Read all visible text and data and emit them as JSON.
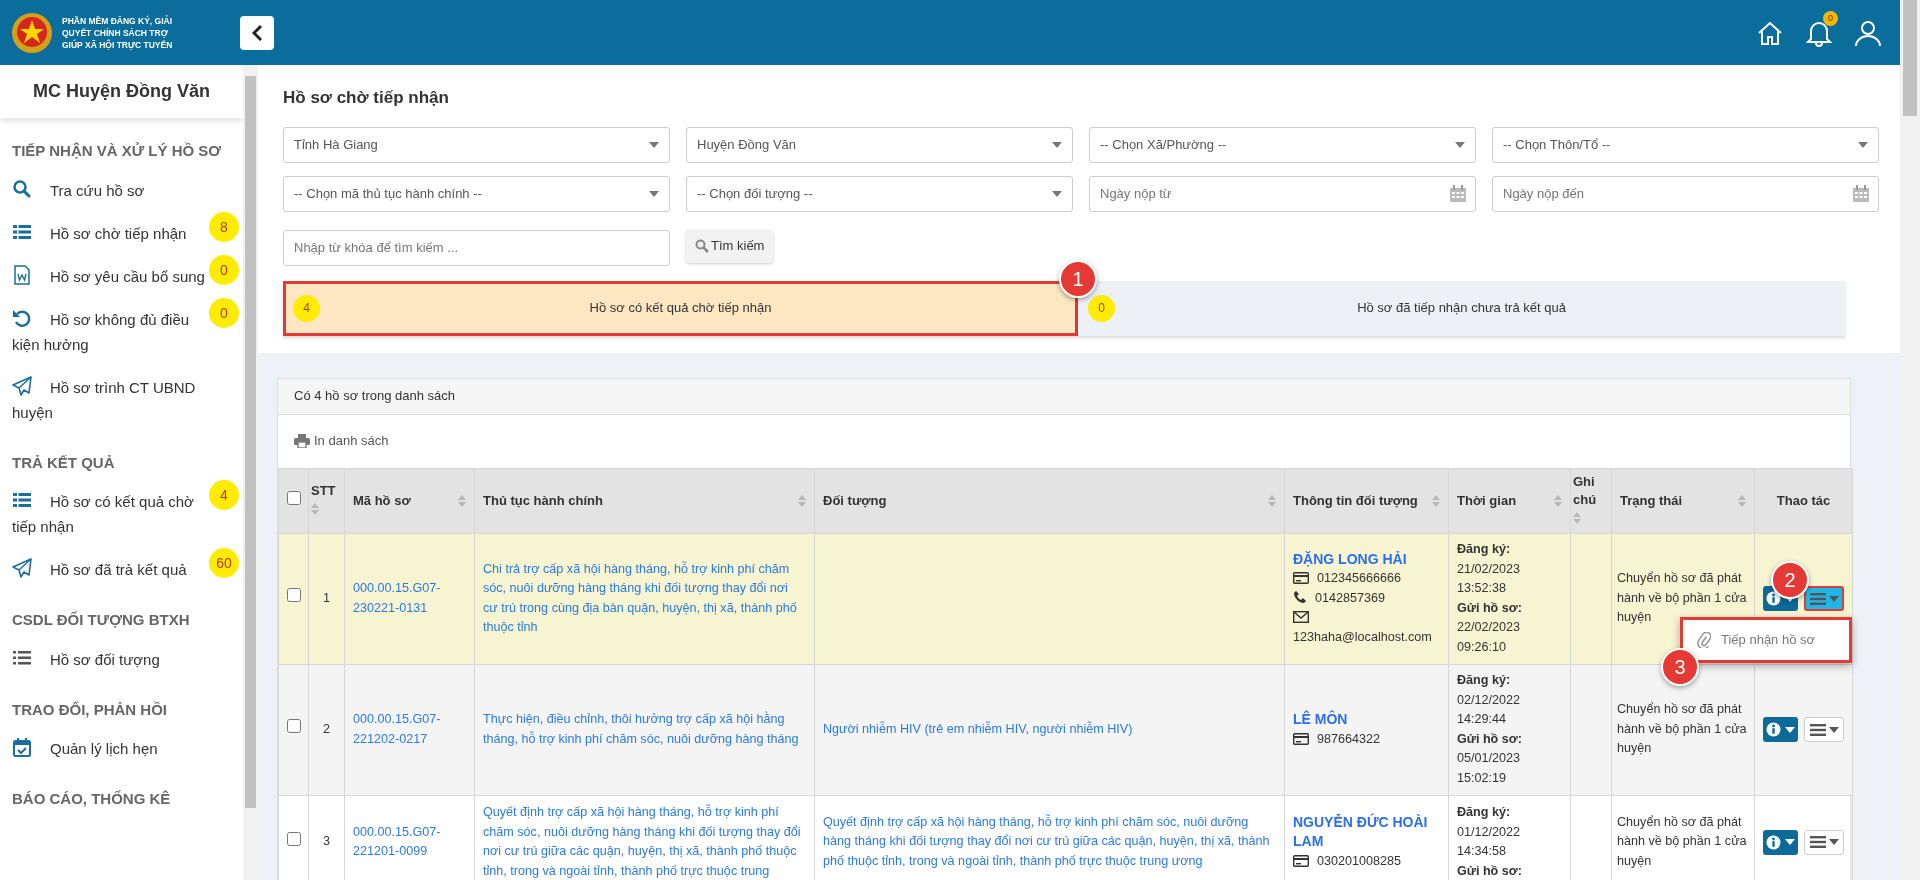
{
  "header": {
    "logo_lines": [
      "PHẦN MỀM ĐĂNG KÝ, GIẢI",
      "QUYẾT CHÍNH SÁCH TRỢ",
      "GIÚP XÃ HỘI TRỰC TUYẾN"
    ],
    "notification_count": "0"
  },
  "sidebar": {
    "title": "MC Huyện Đồng Văn",
    "sections": [
      {
        "heading": "TIẾP NHẬN VÀ XỬ LÝ HỒ SƠ",
        "items": [
          {
            "label": "Tra cứu hồ sơ"
          },
          {
            "label": "Hồ sơ chờ tiếp nhận",
            "badge": "8"
          },
          {
            "label": "Hồ sơ yêu cầu bổ sung",
            "badge": "0"
          },
          {
            "label": "Hồ sơ không đủ điều kiện hưởng",
            "badge": "0"
          },
          {
            "label": "Hồ sơ trình CT UBND huyện"
          }
        ]
      },
      {
        "heading": "TRẢ KẾT QUẢ",
        "items": [
          {
            "label": "Hồ sơ có kết quả chờ tiếp nhận",
            "badge": "4"
          },
          {
            "label": "Hồ sơ đã trả kết quả",
            "badge": "60"
          }
        ]
      },
      {
        "heading": "CSDL ĐỐI TƯỢNG BTXH",
        "items": [
          {
            "label": "Hồ sơ đối tượng"
          }
        ]
      },
      {
        "heading": "TRAO ĐỔI, PHẢN HỒI",
        "items": [
          {
            "label": "Quản lý lịch hẹn"
          }
        ]
      },
      {
        "heading": "BÁO CÁO, THỐNG KÊ"
      }
    ]
  },
  "page_title": "Hồ sơ chờ tiếp nhận",
  "filters": [
    {
      "kind": "select",
      "value": "Tỉnh Hà Giang"
    },
    {
      "kind": "select",
      "value": "Huyện Đồng Văn"
    },
    {
      "kind": "select",
      "value": "-- Chọn Xã/Phường --"
    },
    {
      "kind": "select",
      "value": "-- Chọn Thôn/Tổ --"
    },
    {
      "kind": "select",
      "value": "-- Chọn mã thủ tục hành chính --"
    },
    {
      "kind": "select",
      "value": "-- Chọn đối tượng --"
    },
    {
      "kind": "date",
      "placeholder": "Ngày nộp từ"
    },
    {
      "kind": "date",
      "placeholder": "Ngày nộp đến"
    },
    {
      "kind": "text",
      "placeholder": "Nhập từ khóa để tìm kiếm ..."
    },
    {
      "kind": "button",
      "label": "Tìm kiếm"
    }
  ],
  "tabs": [
    {
      "count": "4",
      "label": "Hồ sơ có kết quả chờ tiếp nhận",
      "selected": true,
      "highlighted": true,
      "marker": "1"
    },
    {
      "count": "0",
      "label": "Hồ sơ đã tiếp nhận chưa trả kết quả",
      "selected": false,
      "highlighted": false
    }
  ],
  "list": {
    "summary": "Có 4 hồ sơ trong danh sách",
    "print_label": "In danh sách",
    "columns": [
      {
        "kind": "checkbox",
        "checked": false
      },
      {
        "label": "STT",
        "sortable": true
      },
      {
        "label": "Mã hồ sơ",
        "sortable": true
      },
      {
        "label": "Thủ tục hành chính",
        "sortable": true
      },
      {
        "label": "Đối tượng",
        "sortable": true
      },
      {
        "label": "Thông tin đối tượng",
        "sortable": true
      },
      {
        "label": "Thời gian",
        "sortable": true
      },
      {
        "label": "Ghi chú",
        "sortable": true
      },
      {
        "label": "Trạng thái",
        "sortable": true
      },
      {
        "label": "Thao tác",
        "sortable": false
      }
    ],
    "rows": [
      {
        "checked": false,
        "highlighted": true,
        "index": "1",
        "code": "000.00.15.G07-230221-0131",
        "procedure": "Chi trả trợ cấp xã hội hàng tháng, hỗ trợ kinh phí chăm sóc, nuôi dưỡng hàng tháng khi đối tượng thay đổi nơi cư trú trong cùng địa bàn quận, huyện, thị xã, thành phố thuộc tỉnh",
        "contact": {
          "name": "ĐẶNG LONG HẢI",
          "lines": [
            {
              "kind": "id",
              "text": "012345666666"
            },
            {
              "kind": "phone",
              "text": "0142857369"
            },
            {
              "kind": "email",
              "text": "123haha@localhost.com"
            }
          ]
        },
        "times": [
          {
            "label": "Đăng ký:",
            "date": "21/02/2023",
            "time": "13:52:38"
          },
          {
            "label": "Gửi hồ sơ:",
            "date": "22/02/2023",
            "time": "09:26:10"
          }
        ],
        "status": "Chuyển hồ sơ đã phát hành về bộ phần 1 cửa huyện",
        "menu": {
          "open": true,
          "button_marker": "2",
          "list_marker": "3",
          "items": [
            {
              "label": "Tiếp nhận hồ sơ"
            }
          ]
        }
      },
      {
        "checked": false,
        "highlighted": false,
        "index": "2",
        "code": "000.00.15.G07-221202-0217",
        "procedure": "Thực hiện, điều chỉnh, thôi hưởng trợ cấp xã hội hằng tháng, hỗ trợ kinh phí chăm sóc, nuôi dưỡng hàng tháng",
        "subject": "Người nhiễm HIV (trẻ em nhiễm HIV, người nhiễm HIV)",
        "contact": {
          "name": "LÊ MÔN",
          "lines": [
            {
              "kind": "id",
              "text": "987664322"
            }
          ]
        },
        "times": [
          {
            "label": "Đăng ký:",
            "date": "02/12/2022",
            "time": "14:29:44"
          },
          {
            "label": "Gửi hồ sơ:",
            "date": "05/01/2023",
            "time": "15:02:19"
          }
        ],
        "status": "Chuyển hồ sơ đã phát hành về bộ phần 1 cửa huyện",
        "menu": {
          "open": false
        }
      },
      {
        "checked": false,
        "highlighted": false,
        "index": "3",
        "code": "000.00.15.G07-221201-0099",
        "procedure": "Quyết định trợ cấp xã hội hàng tháng, hỗ trợ kinh phí chăm sóc, nuôi dưỡng hàng tháng khi đối tượng thay đổi nơi cư trú giữa các quận, huyện, thị xã, thành phố thuộc tỉnh, trong và ngoài tỉnh, thành phố trực thuộc trung",
        "subject": "Quyết định trợ cấp xã hội hàng tháng, hỗ trợ kinh phí chăm sóc, nuôi dưỡng hàng tháng khi đối tượng thay đổi nơi cư trú giữa các quận, huyện, thị xã, thành phố thuộc tỉnh, trong và ngoài tỉnh, thành phố trực thuộc trung ương",
        "contact": {
          "name": "NGUYỄN ĐỨC HOÀI LAM",
          "lines": [
            {
              "kind": "id",
              "text": "030201008285"
            }
          ]
        },
        "times": [
          {
            "label": "Đăng ký:",
            "date": "01/12/2022",
            "time": "14:34:58"
          },
          {
            "label": "Gửi hồ sơ:"
          }
        ],
        "status": "Chuyển hồ sơ đã phát hành về bộ phần 1 cửa huyện",
        "menu": {
          "open": false
        }
      }
    ]
  }
}
